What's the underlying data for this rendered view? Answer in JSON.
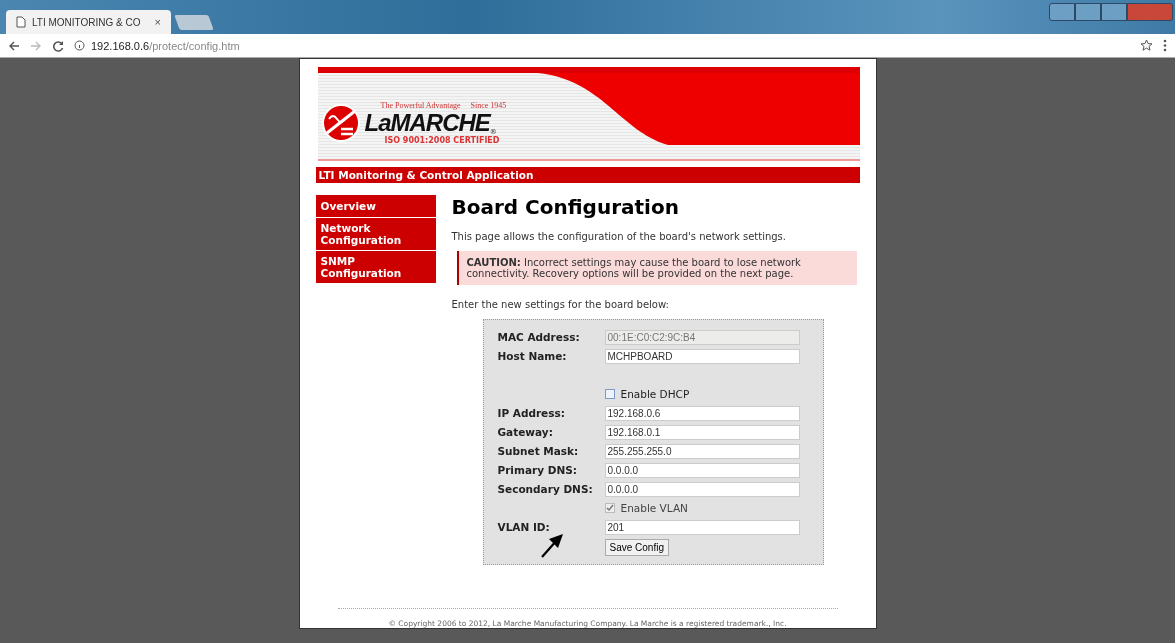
{
  "browser": {
    "tab_title": "LTI MONITORING & CO",
    "tab_close": "×",
    "url_host": "192.168.0.6",
    "url_path": "/protect/config.htm"
  },
  "banner": {
    "tagline": "The Powerful Advantage",
    "since": "Since 1945",
    "logo_name": "LaMARCHE",
    "registered": "®",
    "certified": "ISO 9001:2008 CERTIFIED"
  },
  "app_title": "LTI Monitoring & Control Application",
  "sidebar": {
    "items": [
      {
        "label": "Overview"
      },
      {
        "label": "Network Configuration"
      },
      {
        "label": "SNMP Configuration"
      }
    ]
  },
  "heading": "Board Configuration",
  "intro": "This page allows the configuration of the board's network settings.",
  "caution": "**CAUTION:** Incorrect settings may cause the board to lose network connectivity. Recovery options will be provided on the next page.",
  "form_intro": "Enter the new settings for the board below:",
  "form": {
    "rows": [
      {
        "kind": "field",
        "label": "MAC Address:",
        "value": "00:1E:C0:C2:9C:B4",
        "disabled": true
      },
      {
        "kind": "field",
        "label": "Host Name:",
        "value": "MCHPBOARD",
        "disabled": false
      },
      {
        "kind": "spacer"
      },
      {
        "kind": "checkbox",
        "label": "Enable DHCP",
        "checked": false
      },
      {
        "kind": "field",
        "label": "IP Address:",
        "value": "192.168.0.6",
        "disabled": false
      },
      {
        "kind": "field",
        "label": "Gateway:",
        "value": "192.168.0.1",
        "disabled": false
      },
      {
        "kind": "field",
        "label": "Subnet Mask:",
        "value": "255.255.255.0",
        "disabled": false
      },
      {
        "kind": "field",
        "label": "Primary DNS:",
        "value": "0.0.0.0",
        "disabled": false
      },
      {
        "kind": "field",
        "label": "Secondary DNS:",
        "value": "0.0.0.0",
        "disabled": false
      },
      {
        "kind": "checkbox",
        "label": "Enable VLAN",
        "checked": true
      },
      {
        "kind": "field",
        "label": "VLAN ID:",
        "value": "201",
        "disabled": false
      }
    ],
    "button": "Save Config"
  },
  "footer": "© Copyright 2006 to 2012, La Marche Manufacturing Company. La Marche is a registered trademark., Inc."
}
